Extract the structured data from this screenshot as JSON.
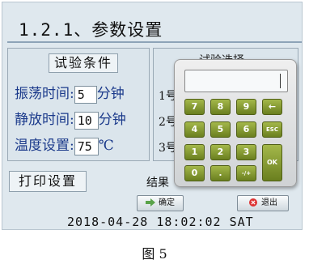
{
  "title": "1.2.1、参数设置",
  "panel_left": {
    "header": "试验条件",
    "rows": [
      {
        "label": "振荡时间:",
        "value": "5",
        "unit": "分钟"
      },
      {
        "label": "静放时间:",
        "value": "10",
        "unit": "分钟"
      },
      {
        "label": "温度设置:",
        "value": "75",
        "unit": "℃"
      }
    ]
  },
  "panel_right": {
    "header": "试验选择",
    "rows": [
      "1号",
      "2号",
      "3号"
    ]
  },
  "print_settings": "打印设置",
  "result_label": "结果",
  "buttons": {
    "confirm": "确定",
    "exit": "退出"
  },
  "datetime": "2018-04-28  18:02:02 SAT",
  "keypad": {
    "keys": [
      "7",
      "8",
      "9",
      "←",
      "4",
      "5",
      "6",
      "ESC",
      "1",
      "2",
      "3",
      "0",
      ".",
      "-/+"
    ],
    "ok": "OK"
  },
  "colors": {
    "key_green": "#8aa030",
    "label_blue": "#1b3a8b",
    "screen_bg": "#dfe8ee"
  },
  "caption": "图 5"
}
